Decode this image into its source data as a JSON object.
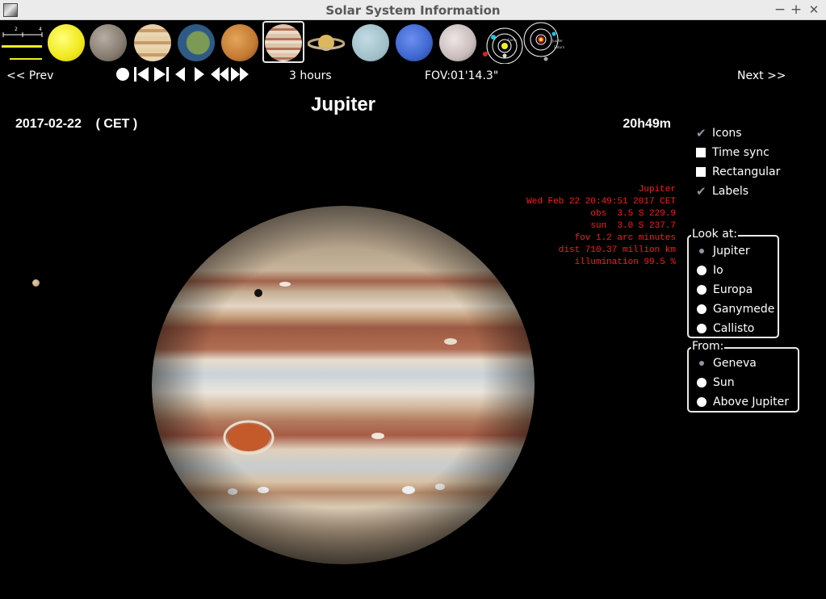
{
  "window": {
    "title": "Solar System Information"
  },
  "titlebar": {
    "minimize": "−",
    "maximize": "+",
    "close": "✕"
  },
  "thumbnails": [
    {
      "name": "sun",
      "color": "#f2ee22"
    },
    {
      "name": "mercury",
      "color": "#8f8476"
    },
    {
      "name": "venus",
      "color": "#d8b384"
    },
    {
      "name": "earth",
      "color": "#2f5b86"
    },
    {
      "name": "mars",
      "color": "#c47a32"
    },
    {
      "name": "jupiter",
      "color": "#cba88a",
      "selected": true
    },
    {
      "name": "saturn",
      "color": "#d9b561"
    },
    {
      "name": "uranus",
      "color": "#a9c6cf"
    },
    {
      "name": "neptune",
      "color": "#3e67cf"
    },
    {
      "name": "pluto",
      "color": "#cfc5c5"
    }
  ],
  "scale_thumb": {
    "tick_left": "2",
    "tick_right": "4"
  },
  "orbit_thumb_labels": {
    "first": "Earth",
    "second_a": "Jupiter",
    "second_b": "Saturn"
  },
  "nav": {
    "prev": "<<  Prev",
    "next": "Next  >>",
    "step": "3 hours",
    "fov": "FOV:01'14.3\""
  },
  "main": {
    "planet_name": "Jupiter",
    "date": "2017-02-22    ( CET )",
    "time": "20h49m"
  },
  "info_lines": [
    "Jupiter",
    "Wed Feb 22 20:49:51 2017 CET",
    "obs  3.5 S 229.9",
    "sun  3.0 S 237.7",
    "fov 1.2 arc minutes",
    "dist 710.37 million km",
    "illumination 99.5 %"
  ],
  "options": [
    {
      "label": "Icons",
      "checked": true
    },
    {
      "label": "Time sync",
      "checked": false
    },
    {
      "label": "Rectangular",
      "checked": false
    },
    {
      "label": "Labels",
      "checked": true
    }
  ],
  "look_at": {
    "legend": "Look at:",
    "items": [
      "Jupiter",
      "Io",
      "Europa",
      "Ganymede",
      "Callisto"
    ],
    "selected": 0
  },
  "from": {
    "legend": "From:",
    "items": [
      "Geneva",
      "Sun",
      "Above Jupiter"
    ],
    "selected": 0
  }
}
